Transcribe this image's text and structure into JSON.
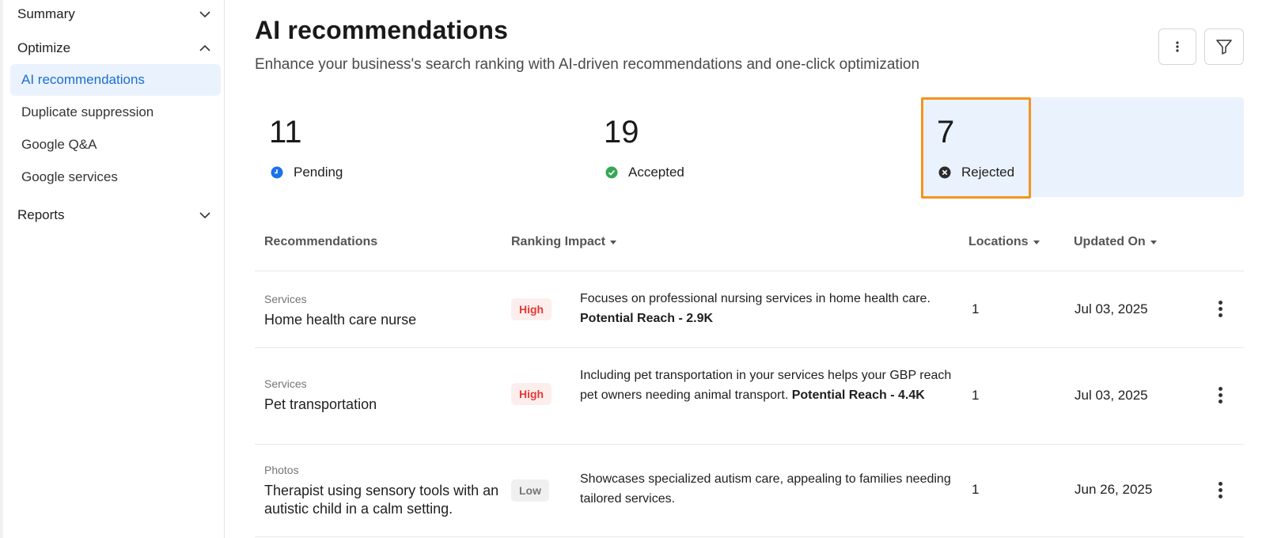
{
  "sidebar": {
    "summary": "Summary",
    "optimize": "Optimize",
    "items": [
      {
        "label": "AI recommendations"
      },
      {
        "label": "Duplicate suppression"
      },
      {
        "label": "Google Q&A"
      },
      {
        "label": "Google services"
      }
    ],
    "reports": "Reports"
  },
  "header": {
    "title": "AI recommendations",
    "subtitle": "Enhance your business's search ranking with AI-driven recommendations and one-click optimization"
  },
  "stats": [
    {
      "value": "11",
      "label": "Pending",
      "icon": "clock-icon",
      "color": "#1a73e8"
    },
    {
      "value": "19",
      "label": "Accepted",
      "icon": "check-circle-icon",
      "color": "#34a853"
    },
    {
      "value": "7",
      "label": "Rejected",
      "icon": "x-circle-icon",
      "color": "#2b2b2b",
      "selected": true
    }
  ],
  "colors": {
    "accent": "#1a6fd1",
    "selection_border": "#f5931e",
    "high": "#e53935"
  },
  "table": {
    "headers": {
      "recommendations": "Recommendations",
      "ranking_impact": "Ranking Impact",
      "locations": "Locations",
      "updated_on": "Updated On"
    },
    "rows": [
      {
        "category": "Services",
        "name": "Home health care nurse",
        "impact": "High",
        "desc": "Focuses on professional nursing services in home health care. ",
        "reach": "Potential Reach - 2.9K",
        "locations": "1",
        "updated": "Jul 03, 2025"
      },
      {
        "category": "Services",
        "name": "Pet transportation",
        "impact": "High",
        "desc": "Including pet transportation in your services helps your GBP reach pet owners needing animal transport. ",
        "reach": "Potential Reach - 4.4K",
        "locations": "1",
        "updated": "Jul 03, 2025"
      },
      {
        "category": "Photos",
        "name": "Therapist using sensory tools with an autistic child in a calm setting.",
        "impact": "Low",
        "desc": "Showcases specialized autism care, appealing to families needing tailored services.",
        "reach": "",
        "locations": "1",
        "updated": "Jun 26, 2025"
      }
    ]
  }
}
